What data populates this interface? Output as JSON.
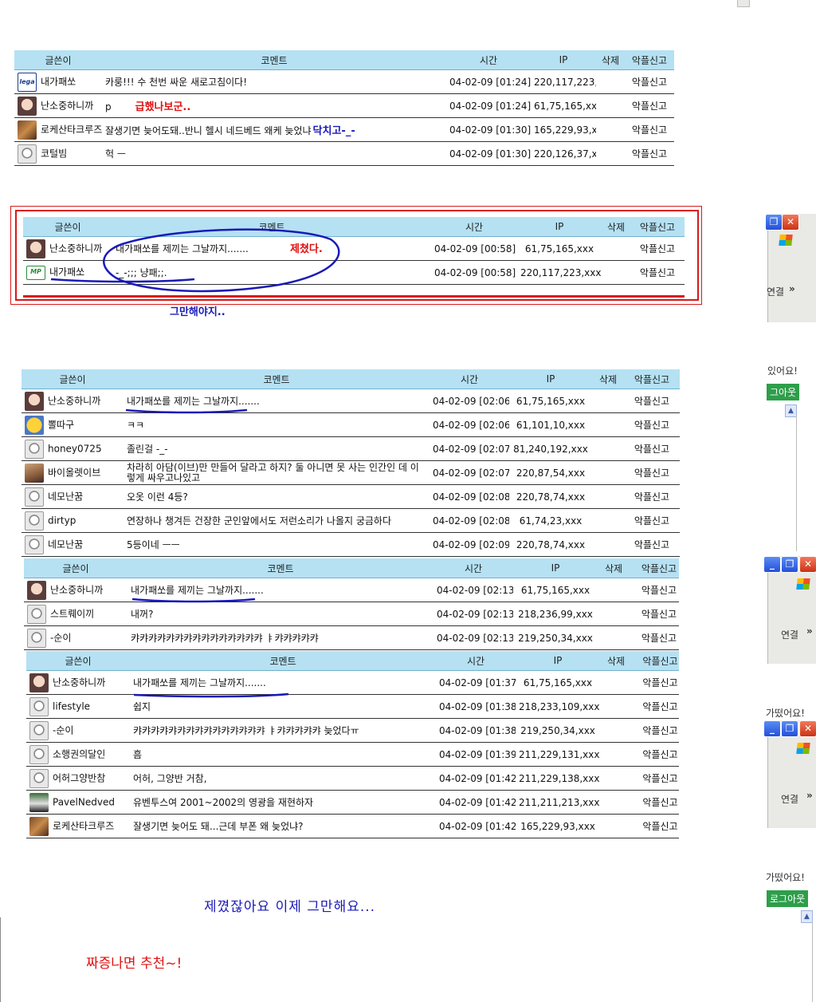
{
  "headers": {
    "author": "글쓴이",
    "comment": "코멘트",
    "time": "시간",
    "ip": "IP",
    "delete": "삭제",
    "report": "악플신고"
  },
  "table1": {
    "rows": [
      {
        "avatar": "logo",
        "author": "내가패쏘",
        "comment": "카룽!!! 수 천번 싸운 새로고침이다!",
        "emph": "",
        "time": "04-02-09 [01:24]",
        "ip": "220,117,223,xxx",
        "report": "악플신고"
      },
      {
        "avatar": "face",
        "author": "난소중하니까",
        "comment": "p",
        "emph": "급했나보군..",
        "time": "04-02-09 [01:24]",
        "ip": "61,75,165,xxx",
        "report": "악플신고"
      },
      {
        "avatar": "pic",
        "author": "로케산타크루즈",
        "comment": "잘생기면 늦어도돼..반니 헬시 네드베드 왜케 늦었냐",
        "emph": "닥치고-_-",
        "time": "04-02-09 [01:30]",
        "ip": "165,229,93,xxx",
        "report": "악플신고"
      },
      {
        "avatar": "ghost",
        "author": "코털빔",
        "comment": "헉 ㅡ",
        "emph": "",
        "time": "04-02-09 [01:30]",
        "ip": "220,126,37,xxx",
        "report": "악플신고"
      }
    ]
  },
  "table2": {
    "rows": [
      {
        "avatar": "face",
        "author": "난소중하니까",
        "comment": "내가패쏘를 제끼는 그날까지.......",
        "time": "04-02-09 [00:58]",
        "ip": "61,75,165,xxx",
        "report": "악플신고"
      },
      {
        "avatar": "mp",
        "author": "내가패쏘",
        "comment": "-_-;;; 냥패;;.",
        "time": "04-02-09 [00:58]",
        "ip": "220,117,223,xxx",
        "report": "악플신고"
      }
    ],
    "annotation_inside": "제쳤다.",
    "annotation_below": "그만해야지.."
  },
  "table3": {
    "rows": [
      {
        "avatar": "face",
        "author": "난소중하니까",
        "comment": "내가패쏘를 제끼는 그날까지.......",
        "time": "04-02-09 [02:06]",
        "ip": "61,75,165,xxx",
        "report": "악플신고"
      },
      {
        "avatar": "yellow",
        "author": "뽈따구",
        "comment": "ㅋㅋ",
        "time": "04-02-09 [02:06]",
        "ip": "61,101,10,xxx",
        "report": "악플신고"
      },
      {
        "avatar": "ghost",
        "author": "honey0725",
        "comment": "졸린걸 -_-",
        "time": "04-02-09 [02:07]",
        "ip": "81,240,192,xxx",
        "report": "악플신고"
      },
      {
        "avatar": "art",
        "author": "바이올렛이브",
        "comment": "차라히 아담(이브)만 만들어 달라고 하지? 둘 아니면 못 사는 인간인 데 이렇게 싸우고나있고",
        "time": "04-02-09 [02:07]",
        "ip": "220,87,54,xxx",
        "report": "악플신고"
      },
      {
        "avatar": "ghost",
        "author": "네모난꿈",
        "comment": "오옷 이런 4등?",
        "time": "04-02-09 [02:08]",
        "ip": "220,78,74,xxx",
        "report": "악플신고"
      },
      {
        "avatar": "ghost",
        "author": "dirtyp",
        "comment": "연장하나 챙겨든 건장한 군인앞에서도 저런소리가 나올지 궁금하다",
        "time": "04-02-09 [02:08]",
        "ip": "61,74,23,xxx",
        "report": "악플신고"
      },
      {
        "avatar": "ghost",
        "author": "네모난꿈",
        "comment": "5등이네 ㅡㅡ",
        "time": "04-02-09 [02:09]",
        "ip": "220,78,74,xxx",
        "report": "악플신고"
      }
    ]
  },
  "table4": {
    "rows": [
      {
        "avatar": "face",
        "author": "난소중하니까",
        "comment": "내가패쏘를 제끼는 그날까지.......",
        "time": "04-02-09 [02:13]",
        "ip": "61,75,165,xxx",
        "report": "악플신고"
      },
      {
        "avatar": "ghost",
        "author": "스트뤠이끼",
        "comment": "내꺼?",
        "time": "04-02-09 [02:13]",
        "ip": "218,236,99,xxx",
        "report": "악플신고"
      },
      {
        "avatar": "ghost",
        "author": "-순이",
        "comment": "캬캬캬캬캬캬캬캬캬캬캬캬캬캬캬 ㅑ캬캬캬캬캬",
        "time": "04-02-09 [02:13]",
        "ip": "219,250,34,xxx",
        "report": "악플신고"
      }
    ]
  },
  "table5": {
    "rows": [
      {
        "avatar": "face",
        "author": "난소중하니까",
        "comment": "내가패쏘를 제끼는 그날까지.......",
        "time": "04-02-09 [01:37]",
        "ip": "61,75,165,xxx",
        "report": "악플신고"
      },
      {
        "avatar": "ghost",
        "author": "lifestyle",
        "comment": "쉽지",
        "time": "04-02-09 [01:38]",
        "ip": "218,233,109,xxx",
        "report": "악플신고"
      },
      {
        "avatar": "ghost",
        "author": "-순이",
        "comment": "캬캬캬캬캬캬캬캬캬캬캬캬캬캬캬 ㅑ캬캬캬캬캬 늦었다ㅠ",
        "time": "04-02-09 [01:38]",
        "ip": "219,250,34,xxx",
        "report": "악플신고"
      },
      {
        "avatar": "ghost",
        "author": "소행권의달인",
        "comment": "흠",
        "time": "04-02-09 [01:39]",
        "ip": "211,229,131,xxx",
        "report": "악플신고"
      },
      {
        "avatar": "ghost",
        "author": "어허그양반참",
        "comment": "어허, 그양반 거참,",
        "time": "04-02-09 [01:42]",
        "ip": "211,229,138,xxx",
        "report": "악플신고"
      },
      {
        "avatar": "soccer",
        "author": "PavelNedved",
        "comment": "유벤투스여 2001~2002의 영광을 재현하자",
        "time": "04-02-09 [01:42]",
        "ip": "211,211,213,xxx",
        "report": "악플신고"
      },
      {
        "avatar": "pic",
        "author": "로케산타크루즈",
        "comment": "잘생기면 늦어도 돼...근데 부폰 왜 늦었냐?",
        "time": "04-02-09 [01:42]",
        "ip": "165,229,93,xxx",
        "report": "악플신고"
      }
    ]
  },
  "footer": {
    "line1": "제꼈잖아요 이제 그만해요...",
    "line2": "짜증나면 추천~!"
  },
  "right_strips": {
    "connect": "연결",
    "chevron": "»",
    "logged_in": "있어요!",
    "logged_in2": "가떴어요!",
    "logout": "그아웃",
    "logout2": "로그아웃"
  },
  "colors": {
    "header_bg": "#b5e1f3",
    "ip_text": "#8a2a8a",
    "annotation_red": "#e01010",
    "annotation_blue": "#1a1ab8",
    "highlight_box": "#d81818"
  }
}
